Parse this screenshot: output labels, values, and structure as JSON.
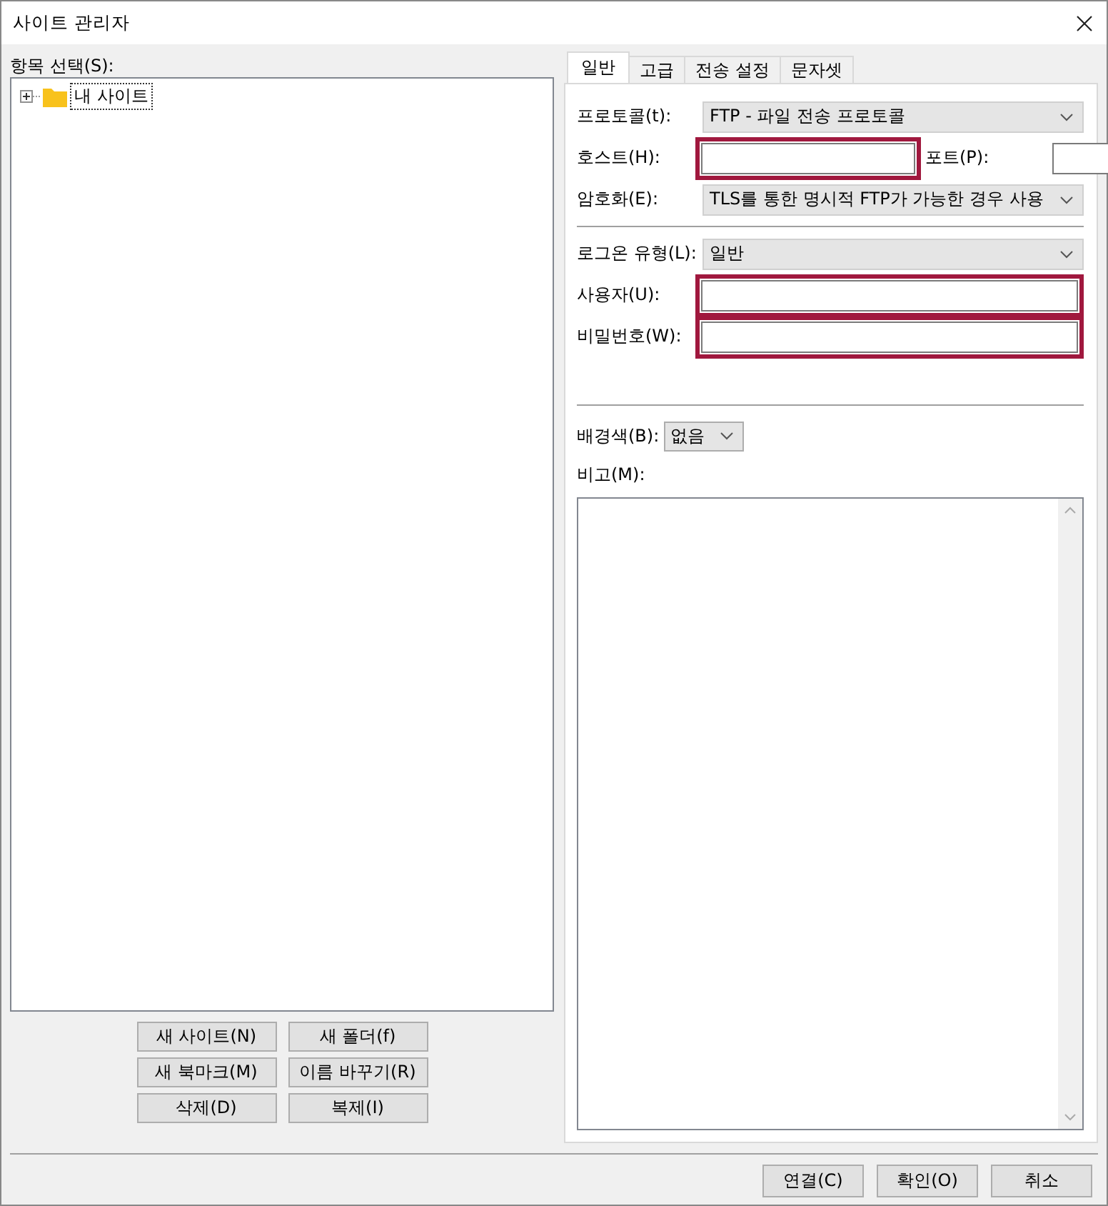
{
  "window": {
    "title": "사이트 관리자"
  },
  "site_tree": {
    "label": "항목 선택(S):",
    "items": [
      {
        "label": "내 사이트",
        "expanded": false,
        "selected": true
      }
    ]
  },
  "tree_buttons": [
    "새 사이트(N)",
    "새 폴더(f)",
    "새 북마크(M)",
    "이름 바꾸기(R)",
    "삭제(D)",
    "복제(I)"
  ],
  "tabs": [
    {
      "label": "일반",
      "selected": true
    },
    {
      "label": "고급",
      "selected": false
    },
    {
      "label": "전송 설정",
      "selected": false
    },
    {
      "label": "문자셋",
      "selected": false
    }
  ],
  "general": {
    "protocol": {
      "label": "프로토콜(t):",
      "value": "FTP - 파일 전송 프로토콜"
    },
    "host": {
      "label": "호스트(H):",
      "highlighted": true
    },
    "port": {
      "label": "포트(P):",
      "highlighted": false
    },
    "encryption": {
      "label": "암호화(E):",
      "value": "TLS를 통한 명시적 FTP가 가능한 경우 사용"
    },
    "logon_type": {
      "label": "로그온 유형(L):",
      "value": "일반"
    },
    "user": {
      "label": "사용자(U):",
      "highlighted": true
    },
    "password": {
      "label": "비밀번호(W):",
      "highlighted": true
    },
    "background_color": {
      "label": "배경색(B):",
      "value": "없음"
    },
    "notes": {
      "label": "비고(M):"
    }
  },
  "footer_buttons": [
    "연결(C)",
    "확인(O)",
    "취소"
  ]
}
